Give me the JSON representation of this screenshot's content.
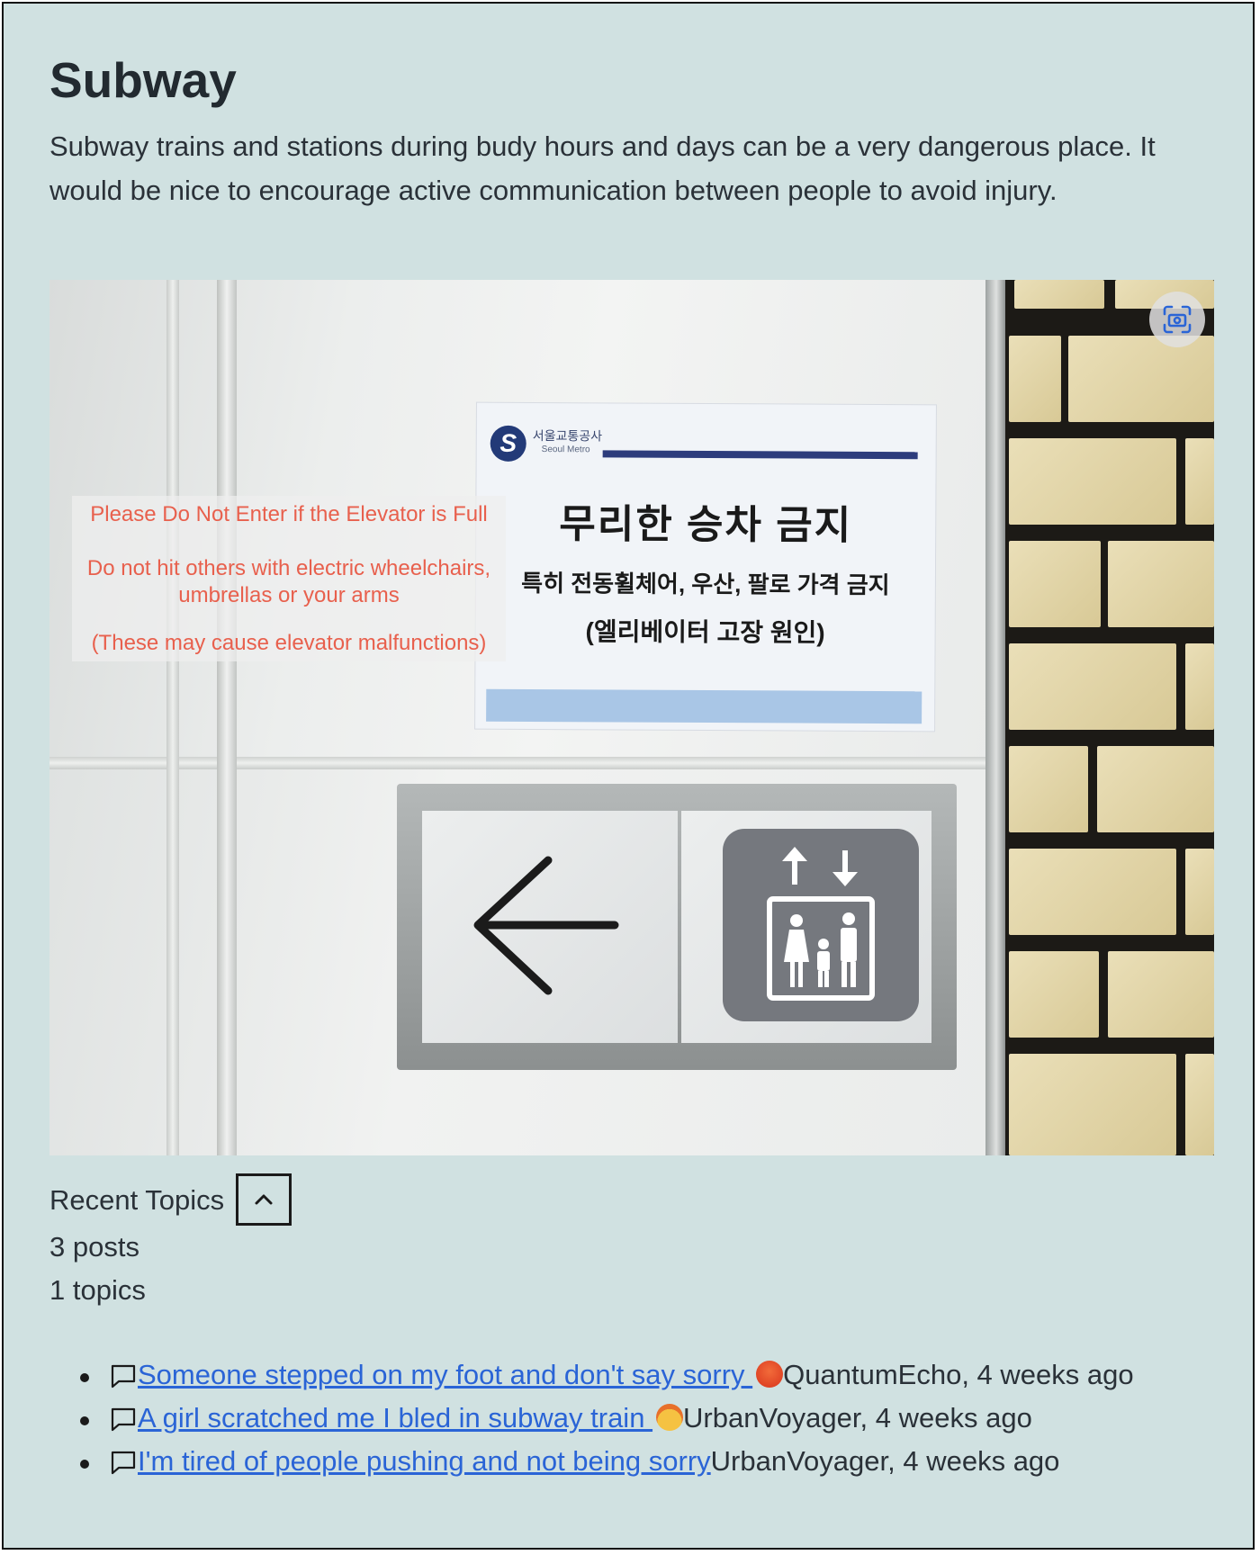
{
  "page": {
    "title": "Subway",
    "description": "Subway trains and stations during budy hours and days can be a very dangerous place. It would be nice to encourage active communication between people to avoid injury."
  },
  "photo": {
    "notice": {
      "org_korean": "서울교통공사",
      "org_english": "Seoul Metro",
      "heading": "무리한 승차 금지",
      "line2": "특히 전동휠체어, 우산, 팔로 가격 금지",
      "line3": "(엘리베이터 고장 원인)"
    },
    "translation": {
      "line1": "Please Do Not Enter if the Elevator is Full",
      "line2": "Do not hit others with electric wheelchairs, umbrellas or your arms",
      "line3": "(These may cause elevator malfunctions)"
    },
    "lens_icon": "camera-scan-icon"
  },
  "topics_section": {
    "label": "Recent Topics",
    "toggle_icon": "chevron-up-icon",
    "posts": "3 posts",
    "topics": "1 topics",
    "items": [
      {
        "title": "Someone stepped on my foot and don't say sorry ",
        "emoji": "angry-face",
        "meta": "QuantumEcho, 4 weeks ago"
      },
      {
        "title": "A girl scratched me I bled in subway train ",
        "emoji": "exploding-head",
        "meta": "UrbanVoyager, 4 weeks ago"
      },
      {
        "title": "I'm tired of people pushing and not being sorry",
        "emoji": "",
        "meta": "UrbanVoyager, 4 weeks ago"
      }
    ]
  },
  "colors": {
    "background": "#d0e1e1",
    "link": "#2a64d6",
    "translation_text": "#e8604d"
  }
}
